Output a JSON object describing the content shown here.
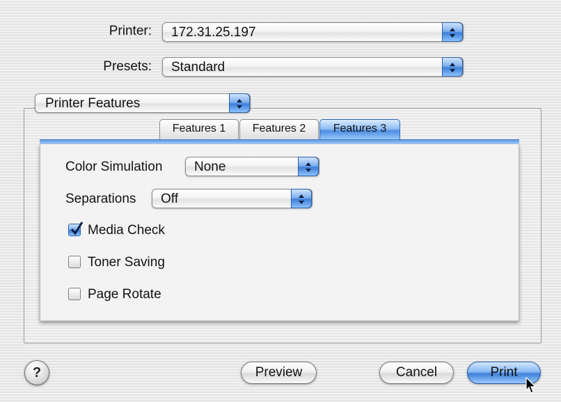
{
  "printer": {
    "label": "Printer:",
    "value": "172.31.25.197"
  },
  "presets": {
    "label": "Presets:",
    "value": "Standard"
  },
  "section_menu": {
    "value": "Printer Features"
  },
  "tabs": [
    {
      "label": "Features 1",
      "active": false
    },
    {
      "label": "Features 2",
      "active": false
    },
    {
      "label": "Features 3",
      "active": true
    }
  ],
  "features": {
    "color_simulation": {
      "label": "Color Simulation",
      "value": "None"
    },
    "separations": {
      "label": "Separations",
      "value": "Off"
    },
    "checkboxes": [
      {
        "label": "Media Check",
        "checked": true
      },
      {
        "label": "Toner Saving",
        "checked": false
      },
      {
        "label": "Page Rotate",
        "checked": false
      }
    ]
  },
  "buttons": {
    "help": "?",
    "preview": "Preview",
    "cancel": "Cancel",
    "print": "Print"
  },
  "colors": {
    "accent": "#3d7fd8",
    "background": "#ececec"
  }
}
